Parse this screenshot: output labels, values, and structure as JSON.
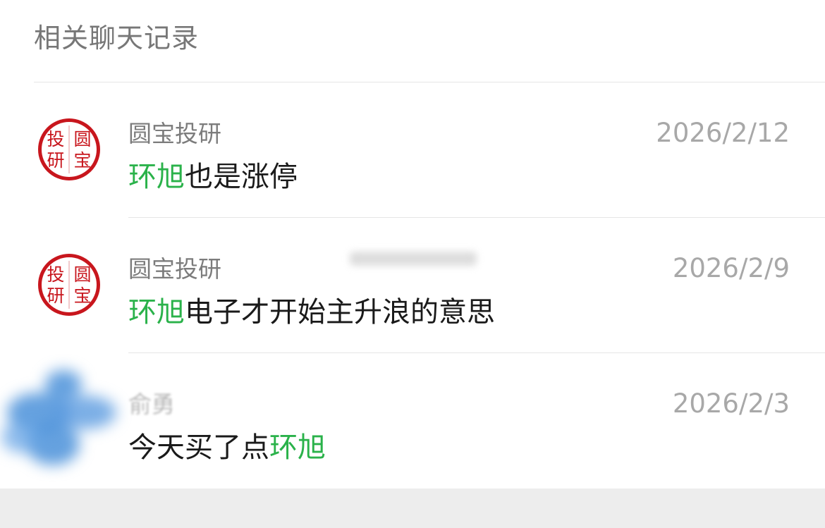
{
  "header": {
    "title": "相关聊天记录"
  },
  "results": [
    {
      "sender": "圆宝投研",
      "date": "2026/2/12",
      "highlight": "环旭",
      "message_rest": "也是涨停",
      "avatar_icon": "red-seal-avatar-icon",
      "avatar_text": "投圆研宝"
    },
    {
      "sender": "圆宝投研",
      "date": "2026/2/9",
      "highlight": "环旭",
      "message_rest": "电子才开始主升浪的意思",
      "avatar_icon": "red-seal-avatar-icon",
      "avatar_text": "投圆研宝"
    },
    {
      "sender": "俞勇",
      "date": "2026/2/3",
      "message_prefix": "今天买了点",
      "highlight": "环旭",
      "avatar_icon": "blurred-avatar-icon"
    }
  ],
  "colors": {
    "highlight": "#2ab24a",
    "seal_red": "#c8161d",
    "text_primary": "#1a1a1a",
    "text_secondary": "#7c7c7c",
    "date": "#a8a8a8",
    "footer_bg": "#ededed"
  }
}
